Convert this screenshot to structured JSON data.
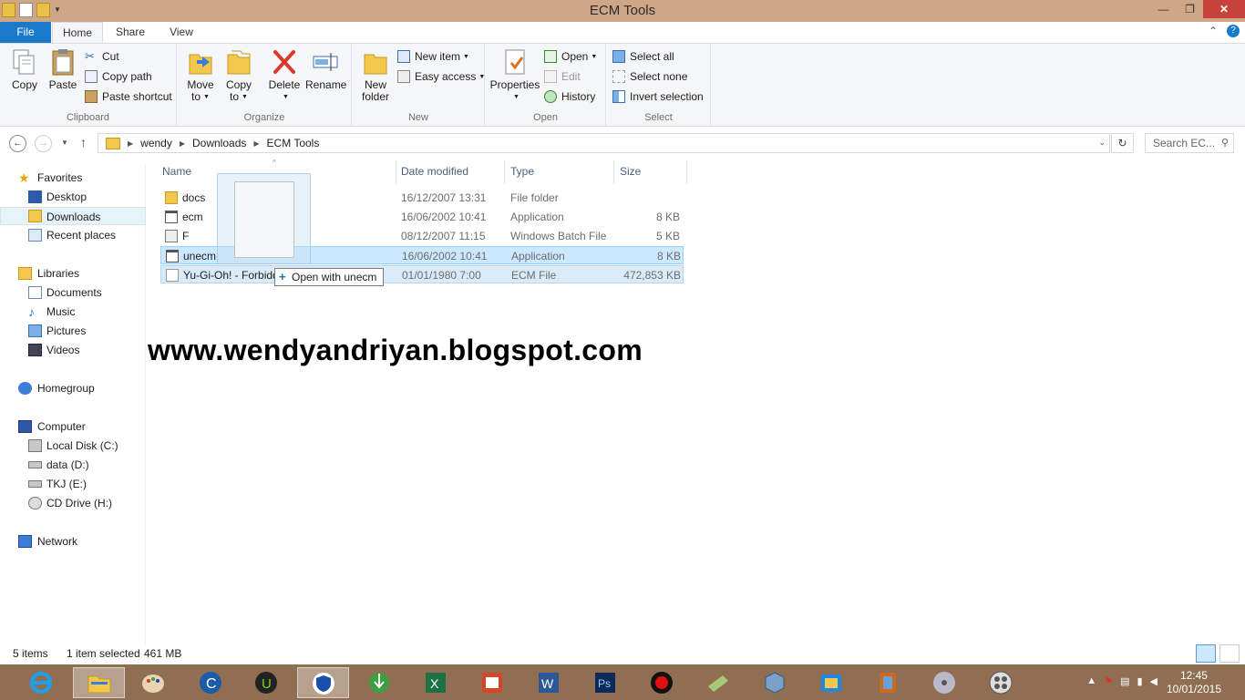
{
  "window": {
    "title": "ECM Tools"
  },
  "ribbon_tabs": {
    "file": "File",
    "home": "Home",
    "share": "Share",
    "view": "View"
  },
  "clipboard": {
    "copy": "Copy",
    "paste": "Paste",
    "cut": "Cut",
    "copy_path": "Copy path",
    "paste_shortcut": "Paste shortcut",
    "label": "Clipboard"
  },
  "organize": {
    "move_to_1": "Move",
    "move_to_2": "to",
    "copy_to_1": "Copy",
    "copy_to_2": "to",
    "delete": "Delete",
    "rename": "Rename",
    "label": "Organize"
  },
  "new": {
    "new_folder_1": "New",
    "new_folder_2": "folder",
    "new_item": "New item",
    "easy_access": "Easy access",
    "label": "New"
  },
  "open": {
    "properties": "Properties",
    "open": "Open",
    "edit": "Edit",
    "history": "History",
    "label": "Open"
  },
  "select": {
    "select_all": "Select all",
    "select_none": "Select none",
    "invert_selection": "Invert selection",
    "label": "Select"
  },
  "address": {
    "crumbs": [
      "wendy",
      "Downloads",
      "ECM Tools"
    ],
    "search_placeholder": "Search EC..."
  },
  "nav": {
    "favorites": "Favorites",
    "desktop": "Desktop",
    "downloads": "Downloads",
    "recent_places": "Recent places",
    "libraries": "Libraries",
    "documents": "Documents",
    "music": "Music",
    "pictures": "Pictures",
    "videos": "Videos",
    "homegroup": "Homegroup",
    "computer": "Computer",
    "local_disk": "Local Disk (C:)",
    "data": "data (D:)",
    "tkj": "TKJ (E:)",
    "cd_drive": "CD Drive (H:)",
    "network": "Network"
  },
  "columns": {
    "name": "Name",
    "date_modified": "Date modified",
    "type": "Type",
    "size": "Size"
  },
  "files": [
    {
      "name": "docs",
      "date": "16/12/2007 13:31",
      "type": "File folder",
      "size": ""
    },
    {
      "name": "ecm",
      "date": "16/06/2002 10:41",
      "type": "Application",
      "size": "8 KB"
    },
    {
      "name": "F",
      "date": "08/12/2007 11:15",
      "type": "Windows Batch File",
      "size": "5 KB"
    },
    {
      "name": "unecm",
      "date": "16/06/2002 10:41",
      "type": "Application",
      "size": "8 KB"
    },
    {
      "name": "Yu-Gi-Oh! - Forbidden Memories.",
      "date": "01/01/1980 7:00",
      "type": "ECM File",
      "size": "472,853 KB"
    }
  ],
  "drag_tooltip": "Open with unecm",
  "watermark": "www.wendyandriyan.blogspot.com",
  "status": {
    "items": "5 items",
    "selected": "1 item selected",
    "size": "461 MB"
  },
  "clock": {
    "time": "12:45",
    "date": "10/01/2015"
  },
  "colors": {
    "file_tab": "#1979ca",
    "titlebar": "#cfa786",
    "taskbar": "#8f6e52",
    "selection": "#cce8ff"
  }
}
